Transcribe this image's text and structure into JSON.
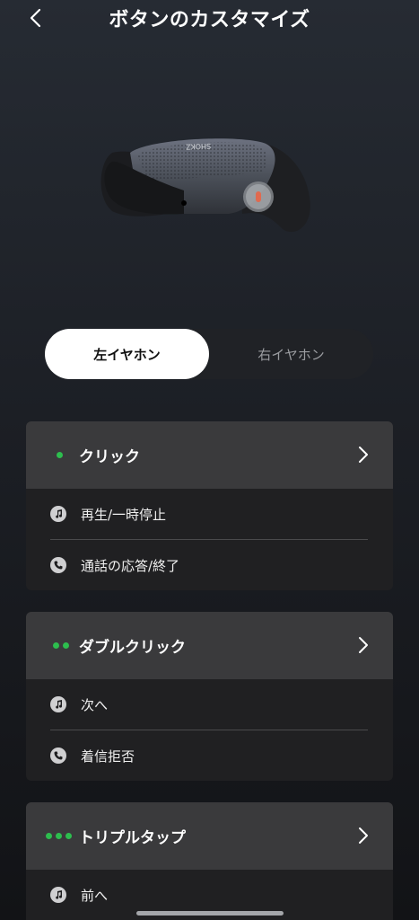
{
  "header": {
    "title": "ボタンのカスタマイズ"
  },
  "device": {
    "brand_text": "SHOKZ"
  },
  "segmented": {
    "left_label": "左イヤホン",
    "right_label": "右イヤホン",
    "selected": "left"
  },
  "cards": [
    {
      "title": "クリック",
      "dots": 1,
      "items": [
        {
          "icon": "music-note-icon",
          "label": "再生/一時停止"
        },
        {
          "icon": "phone-icon",
          "label": "通話の応答/終了"
        }
      ]
    },
    {
      "title": "ダブルクリック",
      "dots": 2,
      "items": [
        {
          "icon": "music-note-icon",
          "label": "次へ"
        },
        {
          "icon": "phone-icon",
          "label": "着信拒否"
        }
      ]
    },
    {
      "title": "トリプルタップ",
      "dots": 3,
      "items": [
        {
          "icon": "music-note-icon",
          "label": "前へ"
        }
      ]
    }
  ],
  "colors": {
    "accent_green": "#2dbd4e",
    "selected_tab_bg": "#ffffff",
    "card_header_bg": "#3a3a3c"
  }
}
